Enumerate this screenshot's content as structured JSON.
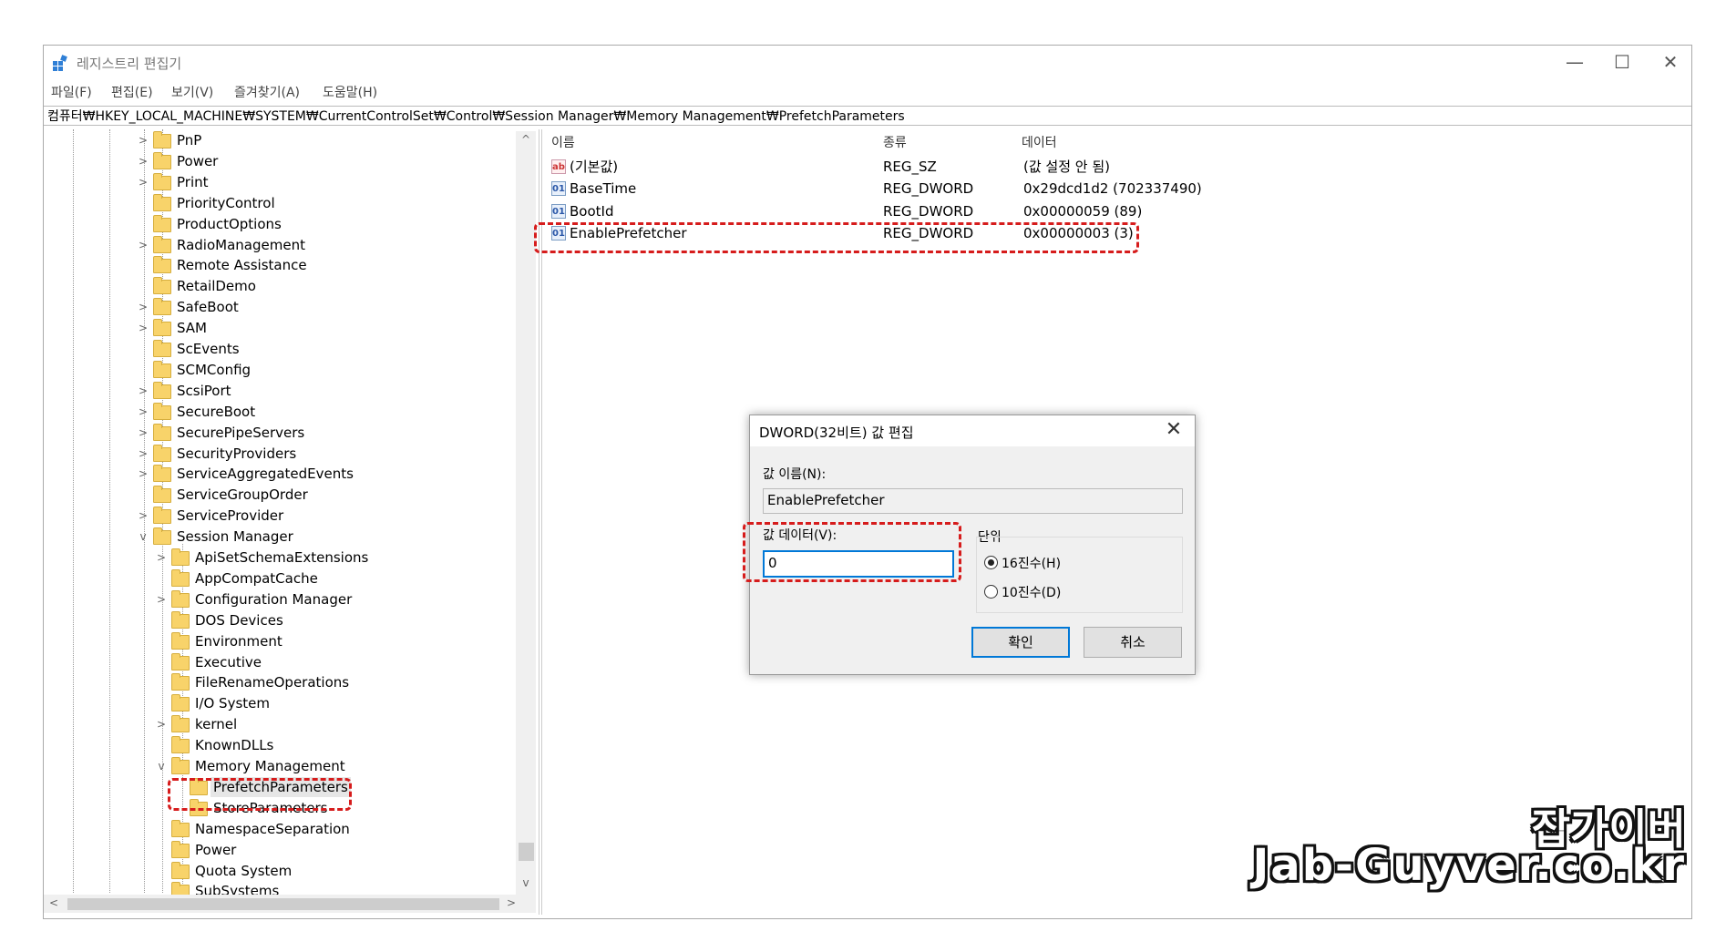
{
  "window": {
    "title": "레지스트리 편집기",
    "minimize_glyph": "—",
    "maximize_glyph": "☐",
    "close_glyph": "✕"
  },
  "menu": [
    "파일(F)",
    "편집(E)",
    "보기(V)",
    "즐겨찾기(A)",
    "도움말(H)"
  ],
  "address": "컴퓨터₩HKEY_LOCAL_MACHINE₩SYSTEM₩CurrentControlSet₩Control₩Session Manager₩Memory Management₩PrefetchParameters",
  "tree": [
    {
      "label": "PnP",
      "level": 0,
      "chevron": ">"
    },
    {
      "label": "Power",
      "level": 0,
      "chevron": ">"
    },
    {
      "label": "Print",
      "level": 0,
      "chevron": ">"
    },
    {
      "label": "PriorityControl",
      "level": 0,
      "chevron": ""
    },
    {
      "label": "ProductOptions",
      "level": 0,
      "chevron": ""
    },
    {
      "label": "RadioManagement",
      "level": 0,
      "chevron": ">"
    },
    {
      "label": "Remote Assistance",
      "level": 0,
      "chevron": ""
    },
    {
      "label": "RetailDemo",
      "level": 0,
      "chevron": ""
    },
    {
      "label": "SafeBoot",
      "level": 0,
      "chevron": ">"
    },
    {
      "label": "SAM",
      "level": 0,
      "chevron": ">"
    },
    {
      "label": "ScEvents",
      "level": 0,
      "chevron": ""
    },
    {
      "label": "SCMConfig",
      "level": 0,
      "chevron": ""
    },
    {
      "label": "ScsiPort",
      "level": 0,
      "chevron": ">"
    },
    {
      "label": "SecureBoot",
      "level": 0,
      "chevron": ">"
    },
    {
      "label": "SecurePipeServers",
      "level": 0,
      "chevron": ">"
    },
    {
      "label": "SecurityProviders",
      "level": 0,
      "chevron": ">"
    },
    {
      "label": "ServiceAggregatedEvents",
      "level": 0,
      "chevron": ">"
    },
    {
      "label": "ServiceGroupOrder",
      "level": 0,
      "chevron": ""
    },
    {
      "label": "ServiceProvider",
      "level": 0,
      "chevron": ">"
    },
    {
      "label": "Session Manager",
      "level": 0,
      "chevron": "v"
    },
    {
      "label": "ApiSetSchemaExtensions",
      "level": 1,
      "chevron": ">"
    },
    {
      "label": "AppCompatCache",
      "level": 1,
      "chevron": ""
    },
    {
      "label": "Configuration Manager",
      "level": 1,
      "chevron": ">"
    },
    {
      "label": "DOS Devices",
      "level": 1,
      "chevron": ""
    },
    {
      "label": "Environment",
      "level": 1,
      "chevron": ""
    },
    {
      "label": "Executive",
      "level": 1,
      "chevron": ""
    },
    {
      "label": "FileRenameOperations",
      "level": 1,
      "chevron": ""
    },
    {
      "label": "I/O System",
      "level": 1,
      "chevron": ""
    },
    {
      "label": "kernel",
      "level": 1,
      "chevron": ">"
    },
    {
      "label": "KnownDLLs",
      "level": 1,
      "chevron": ""
    },
    {
      "label": "Memory Management",
      "level": 1,
      "chevron": "v"
    },
    {
      "label": "PrefetchParameters",
      "level": 2,
      "chevron": "",
      "selected": true
    },
    {
      "label": "StoreParameters",
      "level": 2,
      "chevron": ""
    },
    {
      "label": "NamespaceSeparation",
      "level": 1,
      "chevron": ""
    },
    {
      "label": "Power",
      "level": 1,
      "chevron": ""
    },
    {
      "label": "Quota System",
      "level": 1,
      "chevron": ""
    },
    {
      "label": "SubSystems",
      "level": 1,
      "chevron": ""
    }
  ],
  "scroll": {
    "up": "^",
    "down": "v",
    "left": "<",
    "right": ">"
  },
  "list": {
    "columns": [
      "이름",
      "종류",
      "데이터"
    ],
    "rows": [
      {
        "icon": "ab",
        "name": "(기본값)",
        "type": "REG_SZ",
        "data": "(값 설정 안 됨)"
      },
      {
        "icon": "01",
        "name": "BaseTime",
        "type": "REG_DWORD",
        "data": "0x29dcd1d2 (702337490)"
      },
      {
        "icon": "01",
        "name": "BootId",
        "type": "REG_DWORD",
        "data": "0x00000059 (89)"
      },
      {
        "icon": "01",
        "name": "EnablePrefetcher",
        "type": "REG_DWORD",
        "data": "0x00000003 (3)"
      }
    ]
  },
  "dialog": {
    "title": "DWORD(32비트) 값 편집",
    "close_glyph": "✕",
    "name_label": "값 이름(N):",
    "name_value": "EnablePrefetcher",
    "data_label": "값 데이터(V):",
    "data_value": "0",
    "base_label": "단위",
    "hex_label": "16진수(H)",
    "dec_label": "10진수(D)",
    "ok_label": "확인",
    "cancel_label": "취소"
  },
  "watermark": {
    "line1": "잡가이버",
    "line2": "Jab-Guyver.co.kr"
  }
}
